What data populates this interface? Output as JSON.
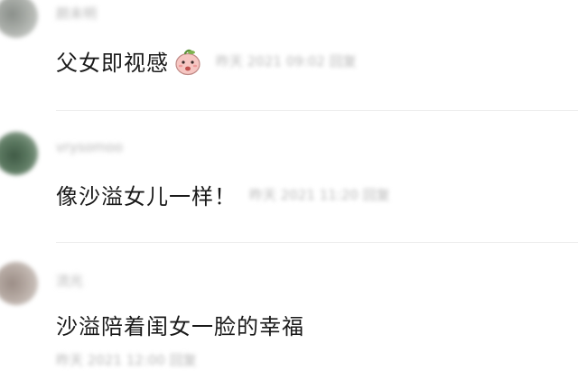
{
  "comments": [
    {
      "author": "颜未明",
      "text": "父女即视感",
      "emoji_icon": "peach-face-emoji-icon",
      "meta": "昨天 2021 09:02 回复"
    },
    {
      "author": "vrysomoo",
      "text": "像沙溢女儿一样！",
      "meta": "昨天 2021 11:20 回复"
    },
    {
      "author": "流光",
      "text": "沙溢陪着闺女一脸的幸福",
      "meta": "昨天 2021 12:00 回复"
    }
  ]
}
